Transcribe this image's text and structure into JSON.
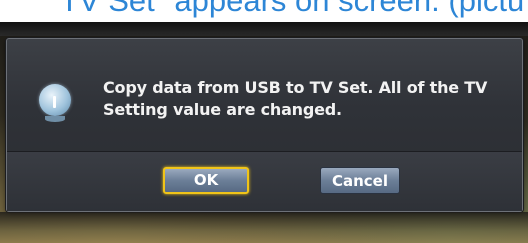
{
  "heading": {
    "text": "TV Set\" appears on screen. (pictu"
  },
  "dialog": {
    "icon": "info-icon",
    "message_line1": "Copy data from USB to TV Set. All of the TV",
    "message_line2": "Setting value are changed.",
    "buttons": {
      "ok_label": "OK",
      "cancel_label": "Cancel"
    }
  },
  "colors": {
    "heading": "#2d86d6",
    "focus": "#f0c419",
    "button": "#6c7f98",
    "dialog_bg": "#2f3238"
  }
}
